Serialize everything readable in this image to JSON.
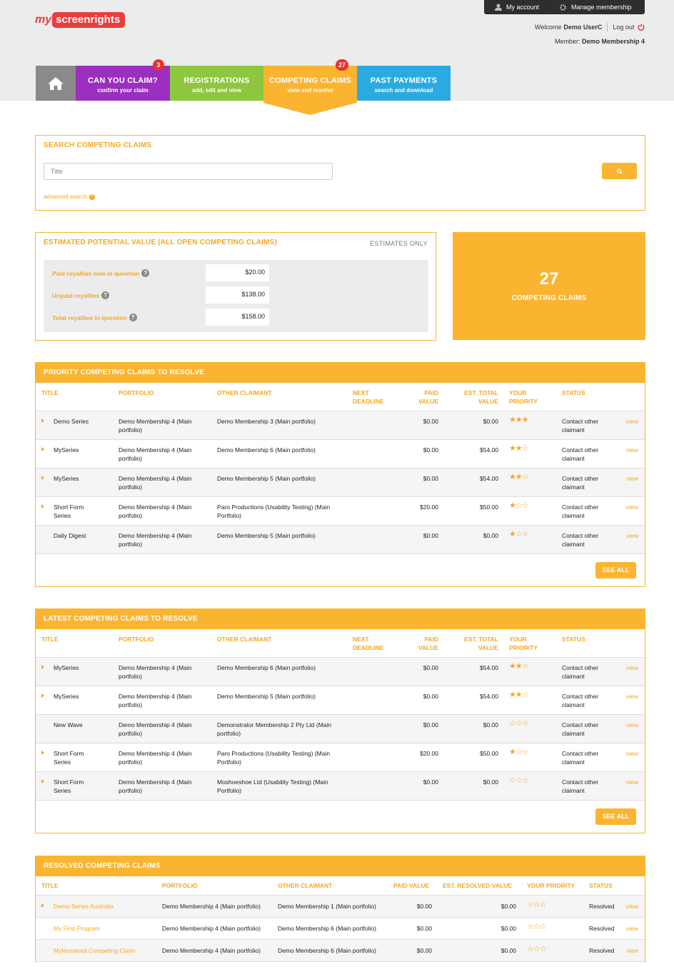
{
  "brand": {
    "prefix": "my",
    "name": "screenrights"
  },
  "topbar": {
    "account": "My account",
    "manage": "Manage membership"
  },
  "user": {
    "welcome": "Welcome",
    "name": "Demo UserC",
    "logout": "Log out",
    "member_label": "Member:",
    "member_name": "Demo Membership 4"
  },
  "tabs": [
    {
      "label": "CAN YOU CLAIM?",
      "sub": "confirm your claim",
      "badge": "3"
    },
    {
      "label": "REGISTRATIONS",
      "sub": "add, edit and view"
    },
    {
      "label": "COMPETING CLAIMS",
      "sub": "view and resolve",
      "badge": "27"
    },
    {
      "label": "PAST PAYMENTS",
      "sub": "search and download"
    }
  ],
  "search": {
    "title": "SEARCH COMPETING CLAIMS",
    "placeholder": "Title",
    "advanced": "advanced search"
  },
  "estimate": {
    "title": "ESTIMATED POTENTIAL VALUE (ALL OPEN COMPETING CLAIMS)",
    "note": "ESTIMATES ONLY",
    "rows": [
      {
        "label": "Paid royalties now in question",
        "value": "$20.00"
      },
      {
        "label": "Unpaid royalties",
        "value": "$138.00"
      },
      {
        "label": "Total royalties in question",
        "value": "$158.00"
      }
    ]
  },
  "count": {
    "number": "27",
    "label": "COMPETING CLAIMS"
  },
  "columns": {
    "title": "TITLE",
    "portfolio": "PORTFOLIO",
    "other": "OTHER CLAIMANT",
    "deadline_1": "NEXT",
    "deadline_2": "DEADLINE",
    "paid_1": "PAID",
    "paid_2": "VALUE",
    "est_1": "EST. TOTAL",
    "est_2": "VALUE",
    "prio_1": "YOUR",
    "prio_2": "PRIORITY",
    "status": "STATUS"
  },
  "priority": {
    "title": "PRIORITY COMPETING CLAIMS TO RESOLVE",
    "see_all": "SEE ALL",
    "rows": [
      {
        "title_1": "Demo Series",
        "title_2": "",
        "caret": true,
        "portfolio_1": "Demo Membership 4 (Main",
        "portfolio_2": "portfolio)",
        "other_1": "Demo Membership 3 (Main portfolio)",
        "other_2": "",
        "paid": "$0.00",
        "est": "$0.00",
        "stars": "★★★",
        "status_1": "Contact other",
        "status_2": "claimant",
        "view": "view"
      },
      {
        "title_1": "MySeries",
        "title_2": "",
        "caret": true,
        "portfolio_1": "Demo Membership 4 (Main",
        "portfolio_2": "portfolio)",
        "other_1": "Demo Membership 6 (Main portfolio)",
        "other_2": "",
        "paid": "$0.00",
        "est": "$54.00",
        "stars": "★★☆",
        "status_1": "Contact other",
        "status_2": "claimant",
        "view": "view"
      },
      {
        "title_1": "MySeries",
        "title_2": "",
        "caret": true,
        "portfolio_1": "Demo Membership 4 (Main",
        "portfolio_2": "portfolio)",
        "other_1": "Demo Membership 5 (Main portfolio)",
        "other_2": "",
        "paid": "$0.00",
        "est": "$54.00",
        "stars": "★★☆",
        "status_1": "Contact other",
        "status_2": "claimant",
        "view": "view"
      },
      {
        "title_1": "Short Form",
        "title_2": "Series",
        "caret": true,
        "portfolio_1": "Demo Membership 4 (Main",
        "portfolio_2": "portfolio)",
        "other_1": "Paro Productions (Usability Testing) (Main",
        "other_2": "Portfolio)",
        "paid": "$20.00",
        "est": "$50.00",
        "stars": "★☆☆",
        "status_1": "Contact other",
        "status_2": "claimant",
        "view": "view"
      },
      {
        "title_1": "Daily Digest",
        "title_2": "",
        "caret": false,
        "portfolio_1": "Demo Membership 4 (Main",
        "portfolio_2": "portfolio)",
        "other_1": "Demo Membership 5 (Main portfolio)",
        "other_2": "",
        "paid": "$0.00",
        "est": "$0.00",
        "stars": "★☆☆",
        "status_1": "Contact other",
        "status_2": "claimant",
        "view": "view"
      }
    ]
  },
  "latest": {
    "title": "LATEST COMPETING CLAIMS TO RESOLVE",
    "see_all": "SEE ALL",
    "rows": [
      {
        "title_1": "MySeries",
        "title_2": "",
        "caret": true,
        "portfolio_1": "Demo Membership 4 (Main",
        "portfolio_2": "portfolio)",
        "other_1": "Demo Membership 6 (Main portfolio)",
        "other_2": "",
        "paid": "$0.00",
        "est": "$54.00",
        "stars": "★★☆",
        "status_1": "Contact other",
        "status_2": "claimant",
        "view": "view"
      },
      {
        "title_1": "MySeries",
        "title_2": "",
        "caret": true,
        "portfolio_1": "Demo Membership 4 (Main",
        "portfolio_2": "portfolio)",
        "other_1": "Demo Membership 5 (Main portfolio)",
        "other_2": "",
        "paid": "$0.00",
        "est": "$54.00",
        "stars": "★★☆",
        "status_1": "Contact other",
        "status_2": "claimant",
        "view": "view"
      },
      {
        "title_1": "New Wave",
        "title_2": "",
        "caret": false,
        "portfolio_1": "Demo Membership 4 (Main",
        "portfolio_2": "portfolio)",
        "other_1": "Demonstrator Membership 2 Pty Ltd (Main",
        "other_2": "portfolio)",
        "paid": "$0.00",
        "est": "$0.00",
        "stars": "☆☆☆",
        "status_1": "Contact other",
        "status_2": "claimant",
        "view": "view"
      },
      {
        "title_1": "Short Form",
        "title_2": "Series",
        "caret": true,
        "portfolio_1": "Demo Membership 4 (Main",
        "portfolio_2": "portfolio)",
        "other_1": "Paro Productions (Usability Testing) (Main",
        "other_2": "Portfolio)",
        "paid": "$20.00",
        "est": "$50.00",
        "stars": "★☆☆",
        "status_1": "Contact other",
        "status_2": "claimant",
        "view": "view"
      },
      {
        "title_1": "Short Form",
        "title_2": "Series",
        "caret": true,
        "portfolio_1": "Demo Membership 4 (Main",
        "portfolio_2": "portfolio)",
        "other_1": "Moshoeshoe Ltd (Usability Testing) (Main",
        "other_2": "Portfolio)",
        "paid": "$0.00",
        "est": "$0.00",
        "stars": "☆☆☆",
        "status_1": "Contact other",
        "status_2": "claimant",
        "view": "view"
      }
    ]
  },
  "resolved": {
    "title": "RESOLVED COMPETING CLAIMS",
    "columns": {
      "title": "TITLE",
      "portfolio": "PORTFOLIO",
      "other": "OTHER CLAIMANT",
      "paid": "PAID VALUE",
      "est": "EST. RESOLVED VALUE",
      "prio": "YOUR PRIORITY",
      "status": "STATUS"
    },
    "rows": [
      {
        "title": "Demo Series Australia",
        "caret": true,
        "portfolio": "Demo Membership 4 (Main portfolio)",
        "other": "Demo Membership 1 (Main portfolio)",
        "paid": "$0.00",
        "est": "$0.00",
        "stars": "☆☆☆",
        "status": "Resolved",
        "view": "view"
      },
      {
        "title": "My First Program",
        "caret": false,
        "portfolio": "Demo Membership 4 (Main portfolio)",
        "other": "Demo Membership 6 (Main portfolio)",
        "paid": "$0.00",
        "est": "$0.00",
        "stars": "☆☆☆",
        "status": "Resolved",
        "view": "view"
      },
      {
        "title": "MyResolved Competing Claim",
        "caret": false,
        "portfolio": "Demo Membership 4 (Main portfolio)",
        "other": "Demo Membership 6 (Main portfolio)",
        "paid": "$0.00",
        "est": "$0.00",
        "stars": "☆☆☆",
        "status": "Resolved",
        "view": "view"
      }
    ]
  },
  "colors": {
    "orange": "#fbb430",
    "purple": "#9b2fbf",
    "green": "#8dc63f",
    "blue": "#29abe2",
    "red": "#e8302e",
    "grey": "#8a8a8a"
  }
}
